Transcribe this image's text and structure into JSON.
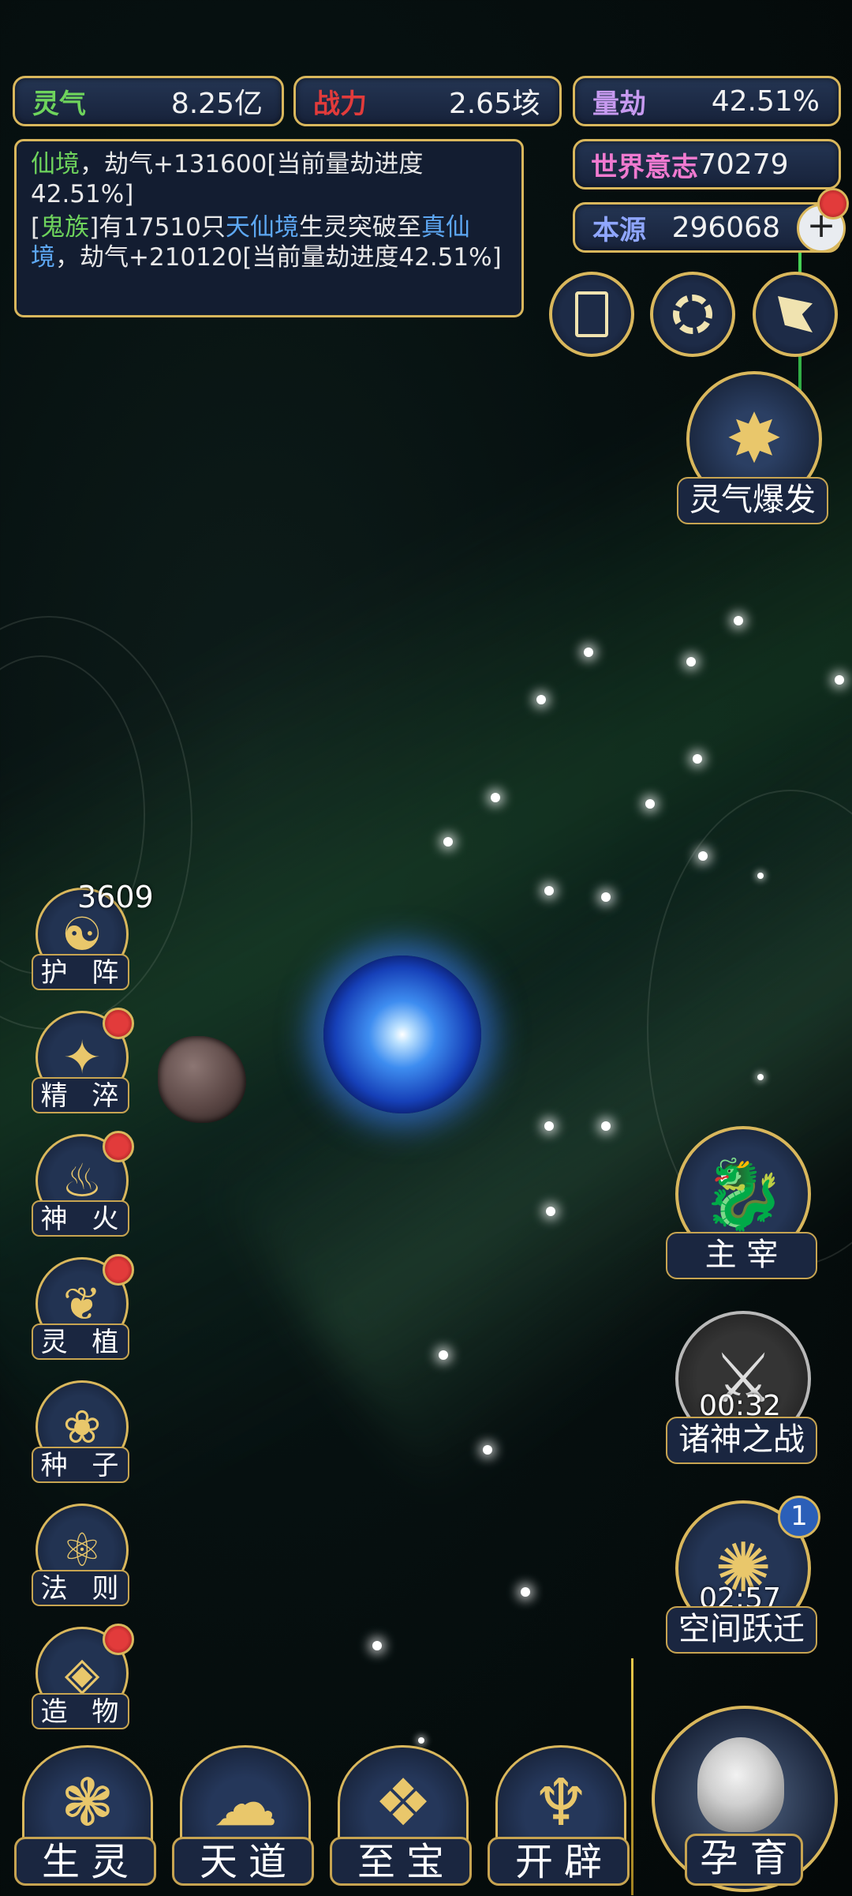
{
  "stats": {
    "lingqi": {
      "label": "灵气",
      "value": "8.25亿"
    },
    "zhanli": {
      "label": "战力",
      "value": "2.65垓"
    },
    "liangjie": {
      "label": "量劫",
      "value": "42.51%"
    },
    "shijie": {
      "label": "世界意志",
      "value": "70279"
    },
    "benyuan": {
      "label": "本源",
      "value": "296068"
    }
  },
  "log": [
    {
      "segments": [
        {
          "text": "仙境",
          "color": "green"
        },
        {
          "text": "，劫气+131600[当前量劫进度42.51%]",
          "color": "white"
        }
      ]
    },
    {
      "segments": [
        {
          "text": "[",
          "color": "white"
        },
        {
          "text": "鬼族",
          "color": "green"
        },
        {
          "text": "]有17510只",
          "color": "white"
        },
        {
          "text": "天仙境",
          "color": "blue"
        },
        {
          "text": "生灵突破至",
          "color": "white"
        },
        {
          "text": "真仙境",
          "color": "blue"
        },
        {
          "text": "，劫气+210120[当前量劫进度42.51%]",
          "color": "white"
        }
      ]
    }
  ],
  "top_icons": [
    "card-icon",
    "vortex-icon",
    "banner-icon"
  ],
  "burst": {
    "label": "灵气爆发"
  },
  "left_menu": [
    {
      "name": "huzhen",
      "label": "护 阵",
      "icon": "yin-yang-icon",
      "glyph": "☯",
      "badge": "3609",
      "dot": false
    },
    {
      "name": "jingcui",
      "label": "精 淬",
      "icon": "flame-crystal-icon",
      "glyph": "✦",
      "dot": true
    },
    {
      "name": "shenhuo",
      "label": "神 火",
      "icon": "divine-fire-icon",
      "glyph": "♨",
      "dot": true
    },
    {
      "name": "lingzhi",
      "label": "灵 植",
      "icon": "spirit-plant-icon",
      "glyph": "❦",
      "dot": true
    },
    {
      "name": "zhongzi",
      "label": "种 子",
      "icon": "seed-icon",
      "glyph": "❀",
      "dot": false
    },
    {
      "name": "faze",
      "label": "法 则",
      "icon": "law-icon",
      "glyph": "⚛",
      "dot": false
    },
    {
      "name": "zaowu",
      "label": "造 物",
      "icon": "creation-icon",
      "glyph": "◈",
      "dot": true
    }
  ],
  "right_menu": {
    "zhuzai": {
      "label": "主 宰",
      "icon": "dragon-icon",
      "glyph": "🐉"
    },
    "zhushen": {
      "label": "诸神之战",
      "timer": "00:32",
      "icon": "sword-icon",
      "glyph": "⚔"
    },
    "kongjian": {
      "label": "空间跃迁",
      "timer": "02:57",
      "badge": "1",
      "icon": "portal-icon",
      "glyph": "✺"
    }
  },
  "bottom_menu": [
    {
      "name": "shengling",
      "label": "生灵",
      "icon": "phoenix-icon",
      "glyph": "❃"
    },
    {
      "name": "tiandao",
      "label": "天道",
      "icon": "cloud-swirl-icon",
      "glyph": "☁"
    },
    {
      "name": "zhibao",
      "label": "至宝",
      "icon": "treasure-icon",
      "glyph": "❖"
    },
    {
      "name": "kaipi",
      "label": "开辟",
      "icon": "axe-flame-icon",
      "glyph": "♆"
    }
  ],
  "yunyu": {
    "label": "孕 育",
    "icon": "mother-child-icon"
  },
  "colors": {
    "gold": "#d9b75c",
    "panel": "#1a2640",
    "green": "#6ed35c",
    "blue": "#5da7f2",
    "red_dot": "#e23b3b"
  }
}
